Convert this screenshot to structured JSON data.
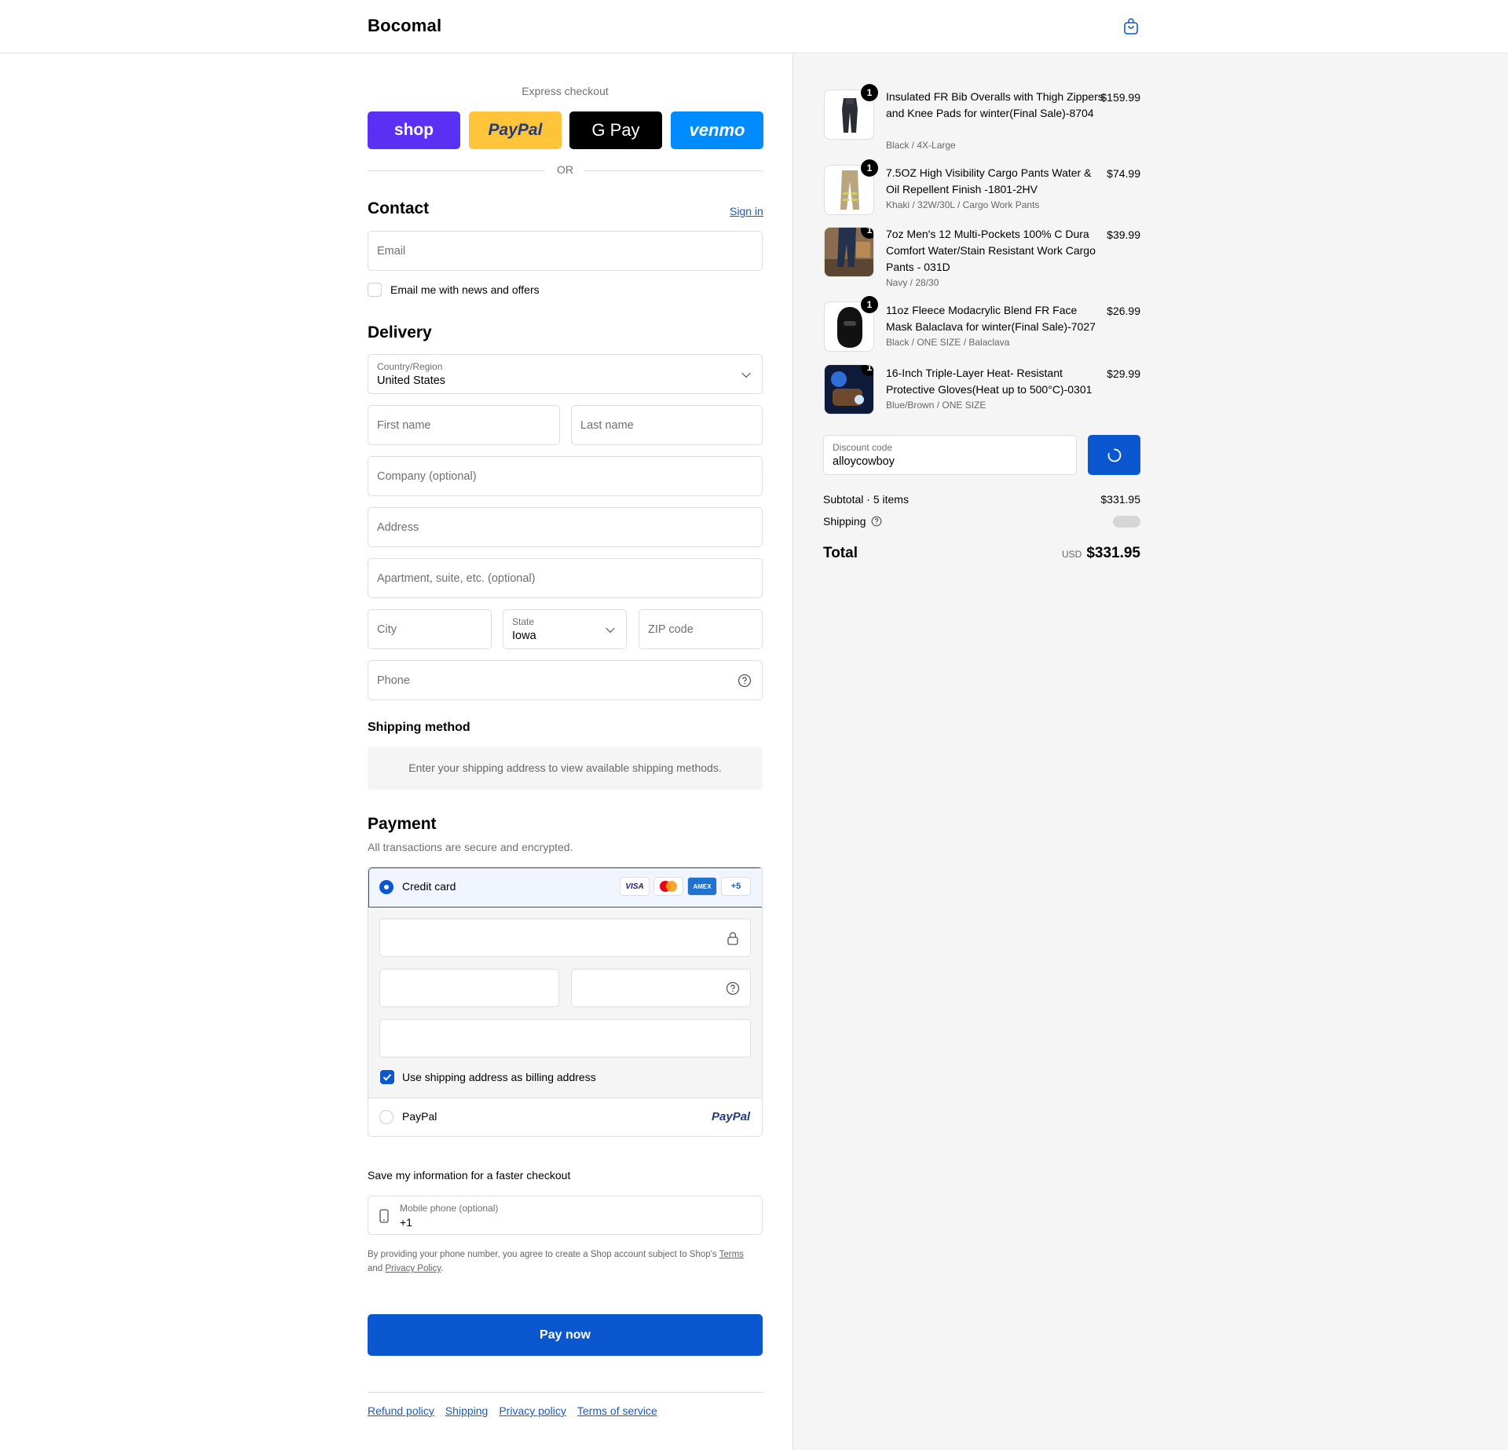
{
  "header": {
    "brand": "Bocomal",
    "cart_icon": "shopping-bag-icon"
  },
  "express": {
    "title": "Express checkout",
    "buttons": [
      {
        "label": "shop",
        "color": "#5a31f4"
      },
      {
        "label": "PayPal",
        "color": "#ffc439"
      },
      {
        "label": "G Pay",
        "color": "#000000"
      },
      {
        "label": "venmo",
        "color": "#008cff"
      }
    ],
    "or": "OR"
  },
  "contact": {
    "title": "Contact",
    "sign_in": "Sign in",
    "email_placeholder": "Email",
    "news_label": "Email me with news and offers"
  },
  "delivery": {
    "title": "Delivery",
    "country_label": "Country/Region",
    "country_value": "United States",
    "first_name": "First name",
    "last_name": "Last name",
    "company": "Company (optional)",
    "address": "Address",
    "apartment": "Apartment, suite, etc. (optional)",
    "city": "City",
    "state_label": "State",
    "state_value": "Iowa",
    "zip": "ZIP code",
    "phone": "Phone"
  },
  "shipping_method": {
    "title": "Shipping method",
    "message": "Enter your shipping address to view available shipping methods."
  },
  "payment": {
    "title": "Payment",
    "subtitle": "All transactions are secure and encrypted.",
    "credit_card_label": "Credit card",
    "card_badges": [
      "VISA",
      "",
      "AMEX",
      "+5"
    ],
    "billing_label": "Use shipping address as billing address",
    "paypal_label": "PayPal",
    "paypal_logo": "PayPal"
  },
  "save_info": {
    "title": "Save my information for a faster checkout",
    "mobile_label": "Mobile phone (optional)",
    "mobile_value": "+1",
    "disclaimer_pre": "By providing your phone number, you agree to create a Shop account subject to Shop's ",
    "terms": "Terms",
    "and": "and ",
    "privacy": "Privacy Policy",
    "period": "."
  },
  "pay_now": "Pay now",
  "footer_links": [
    "Refund policy",
    "Shipping",
    "Privacy policy",
    "Terms of service"
  ],
  "order": {
    "items": [
      {
        "qty": "1",
        "title": "Insulated FR Bib Overalls with Thigh Zippers and Knee Pads for winter(Final Sale)-8704",
        "variant": "Black / 4X-Large",
        "price": "$159.99"
      },
      {
        "qty": "1",
        "title": "7.5OZ High Visibility Cargo Pants Water & Oil Repellent Finish -1801-2HV",
        "variant": "Khaki / 32W/30L / Cargo Work Pants",
        "price": "$74.99"
      },
      {
        "qty": "1",
        "title": "7oz Men's 12 Multi-Pockets 100% C Dura Comfort Water/Stain Resistant Work Cargo Pants - 031D",
        "variant": "Navy / 28/30",
        "price": "$39.99"
      },
      {
        "qty": "1",
        "title": "11oz Fleece Modacrylic Blend FR Face Mask Balaclava for winter(Final Sale)-7027",
        "variant": "Black / ONE SIZE / Balaclava",
        "price": "$26.99"
      },
      {
        "qty": "1",
        "title": "16-Inch Triple-Layer Heat- Resistant Protective Gloves(Heat up to 500°C)-0301",
        "variant": "Blue/Brown / ONE SIZE",
        "price": "$29.99"
      }
    ],
    "discount_label": "Discount code",
    "discount_value": "alloycowboy",
    "subtotal_label": "Subtotal · 5 items",
    "subtotal_value": "$331.95",
    "shipping_label": "Shipping",
    "total_label": "Total",
    "currency": "USD",
    "total_value": "$331.95"
  },
  "colors": {
    "accent": "#0b57d0",
    "link": "#1a59c4"
  }
}
